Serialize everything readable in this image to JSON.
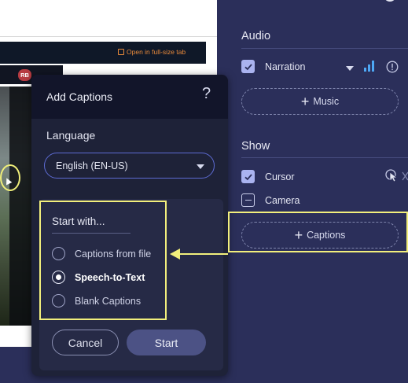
{
  "background_app": {
    "open_tab_label": "Open in full-size tab",
    "avatar_initials": "RB"
  },
  "right_panel": {
    "audio": {
      "title": "Audio",
      "narration_label": "Narration",
      "narration_checked": true,
      "music_button_label": "Music"
    },
    "show": {
      "title": "Show",
      "cursor_label": "Cursor",
      "cursor_checked": true,
      "camera_label": "Camera",
      "camera_state": "indeterminate",
      "captions_button_label": "Captions"
    }
  },
  "dialog": {
    "title": "Add Captions",
    "help_glyph": "?",
    "language_label": "Language",
    "language_value": "English (EN-US)",
    "start_with_label": "Start with...",
    "options": [
      {
        "label": "Captions from file",
        "selected": false
      },
      {
        "label": "Speech-to-Text",
        "selected": true
      },
      {
        "label": "Blank Captions",
        "selected": false
      }
    ],
    "cancel_label": "Cancel",
    "start_label": "Start"
  },
  "colors": {
    "panel_bg": "#2b2f5a",
    "dialog_bg": "#1e2238",
    "accent": "#5d6bd3",
    "highlight": "#f2ef7c",
    "checkbox": "#aab3f0"
  },
  "icons": [
    "external-link-icon",
    "help-icon",
    "dropdown-caret-icon",
    "checkmark-icon",
    "plus-icon",
    "audio-level-icon",
    "info-icon",
    "pointer-icon",
    "close-icon"
  ]
}
